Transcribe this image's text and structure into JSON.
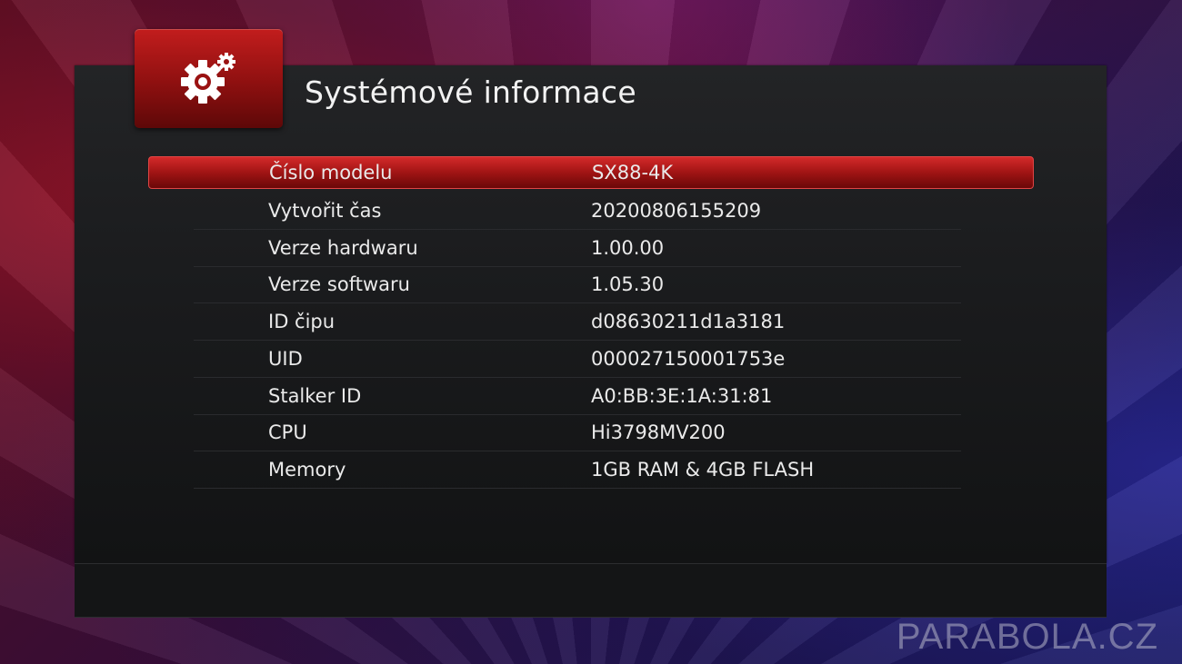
{
  "header": {
    "icon": "gear-icon",
    "title": "Systémové informace"
  },
  "info_rows": [
    {
      "label": "Číslo modelu",
      "value": "SX88-4K",
      "selected": true
    },
    {
      "label": "Vytvořit čas",
      "value": "20200806155209"
    },
    {
      "label": "Verze hardwaru",
      "value": "1.00.00"
    },
    {
      "label": "Verze softwaru",
      "value": "1.05.30"
    },
    {
      "label": "ID čipu",
      "value": "d08630211d1a3181"
    },
    {
      "label": "UID",
      "value": "000027150001753e"
    },
    {
      "label": "Stalker ID",
      "value": "A0:BB:3E:1A:31:81"
    },
    {
      "label": "CPU",
      "value": "Hi3798MV200"
    },
    {
      "label": "Memory",
      "value": "1GB RAM & 4GB FLASH"
    }
  ],
  "watermark": "PARABOLA.CZ",
  "colors": {
    "accent": "#c21d1d",
    "text": "#eaeaea"
  }
}
